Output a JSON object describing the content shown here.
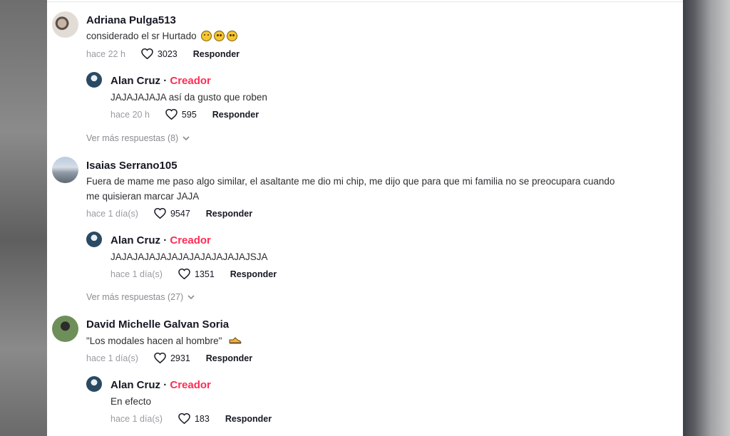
{
  "comments": [
    {
      "user": "Adriana Pulga513",
      "text": "considerado el sr Hurtado",
      "emojis": [
        "face-with-tears-of-joy",
        "flushed-face",
        "flushed-face"
      ],
      "time": "hace 22 h",
      "likes": "3023",
      "reply_label": "Responder",
      "reply": {
        "user": "Alan Cruz",
        "separator": "·",
        "badge": "Creador",
        "text": "JAJAJAJAJA así da gusto que roben",
        "time": "hace 20 h",
        "likes": "595",
        "reply_label": "Responder"
      },
      "more_replies": "Ver más respuestas (8)"
    },
    {
      "user": "Isaias Serrano105",
      "text_line1": "Fuera de mame me paso algo similar, el asaltante me dio mi chip, me dijo que para que mi familia no se preocupara cuando",
      "text_line2": "me quisieran marcar JAJA",
      "time": "hace 1 día(s)",
      "likes": "9547",
      "reply_label": "Responder",
      "reply": {
        "user": "Alan Cruz",
        "separator": "·",
        "badge": "Creador",
        "text": "JAJAJAJAJAJAJAJAJAJAJAJAJSJA",
        "time": "hace 1 día(s)",
        "likes": "1351",
        "reply_label": "Responder"
      },
      "more_replies": "Ver más respuestas (27)"
    },
    {
      "user": "David Michelle Galvan Soria",
      "text": "\"Los modales hacen al hombre\"",
      "emojis": [
        "shoe"
      ],
      "time": "hace 1 día(s)",
      "likes": "2931",
      "reply_label": "Responder",
      "reply": {
        "user": "Alan Cruz",
        "separator": "·",
        "badge": "Creador",
        "text": "En efecto",
        "time": "hace 1 día(s)",
        "likes": "183",
        "reply_label": "Responder"
      }
    }
  ],
  "colors": {
    "creator_badge": "#fe2c55",
    "username": "#161823",
    "meta": "#8a8b91"
  }
}
